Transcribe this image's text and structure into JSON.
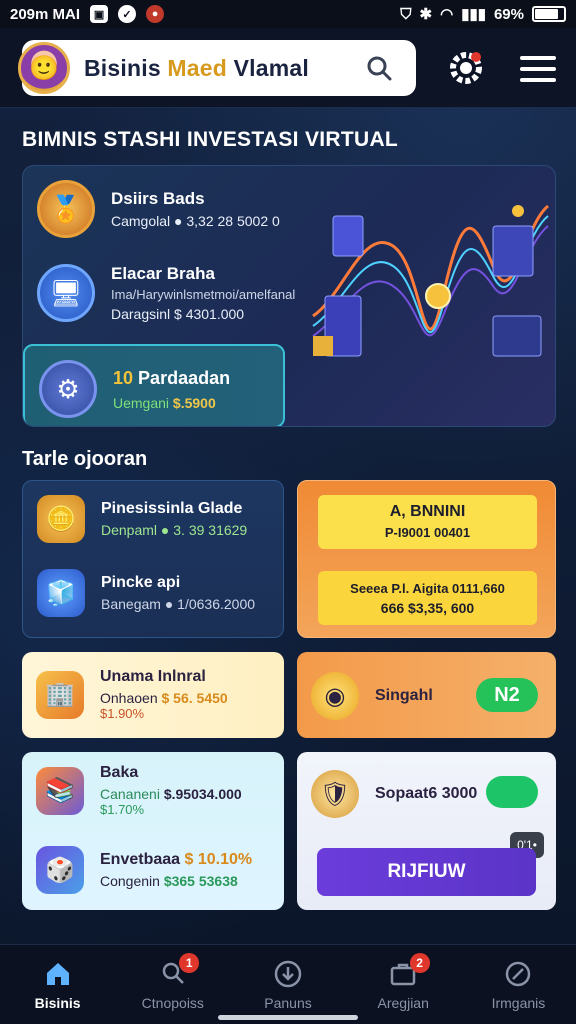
{
  "status_bar": {
    "time": "209m MAI",
    "battery": "69%"
  },
  "header": {
    "brand_part1": "Bisinis ",
    "brand_accent": "Maed",
    "brand_part2": " Vlamal"
  },
  "page_title": "BIMNIS STASHI INVESTASI VIRTUAL",
  "hero": {
    "items": [
      {
        "title": "Dsiirs Bads",
        "sub": "",
        "value": "Camgolal ● 3,32 28 5002 0"
      },
      {
        "title": "Elacar Braha",
        "sub": "Ima/Harywinlsmetmoi/amelfanal",
        "value": "Daragsinl $ 4301.000"
      }
    ],
    "selected": {
      "title": "Pardaadan",
      "title_prefix": "10",
      "value_label": "Uemgani",
      "value_amount": "$.5900"
    }
  },
  "section_title": "Tarle ojooran",
  "cards": {
    "c1": {
      "rows": [
        {
          "title": "Pinesissinla Glade",
          "value": "Denpaml ● 3. 39 31629"
        },
        {
          "title": "Pincke api",
          "value": "Banegam ● 1/0636.2000"
        }
      ]
    },
    "c2": {
      "box1_line1": "A, BNNINI",
      "box1_line2": "P-I9001 00401",
      "box2_line1": "Seeea  P.l. Aigita 0111,660",
      "box2_line2": "666 $3,35, 600"
    },
    "c3": {
      "title": "Unama Inlnral",
      "value_label": "Onhaoen",
      "value_amount": "$ 56. 5450",
      "percent": "$1.90%"
    },
    "c4": {
      "title": "Singahl",
      "pill": "N2"
    },
    "c5": {
      "rows": [
        {
          "title": "Baka",
          "label": "Cananeni",
          "amount": "$.95034.000",
          "percent": "$1.70%"
        },
        {
          "title": "Envetbaaa",
          "amount": "$ 10.10%",
          "label": "Congenin",
          "percent": "$365 53638"
        }
      ]
    },
    "c6": {
      "title": "Sopaat6 3000",
      "chip": "0'1•",
      "cta": "RIJFIUW"
    }
  },
  "nav": [
    {
      "label": "Bisinis",
      "icon": "home-icon",
      "active": true,
      "badge": ""
    },
    {
      "label": "Ctnopoiss",
      "icon": "search-person-icon",
      "active": false,
      "badge": "1"
    },
    {
      "label": "Panuns",
      "icon": "download-circle-icon",
      "active": false,
      "badge": ""
    },
    {
      "label": "Aregjian",
      "icon": "briefcase-icon",
      "active": false,
      "badge": "2"
    },
    {
      "label": "Irmganis",
      "icon": "settings-icon",
      "active": false,
      "badge": ""
    }
  ],
  "colors": {
    "accent_gold": "#d79a1e",
    "background": "#0f1d35",
    "orange_card": "#f08a35",
    "green_pill": "#25c25a",
    "purple_cta": "#5b34c7",
    "badge_red": "#e0372c"
  }
}
